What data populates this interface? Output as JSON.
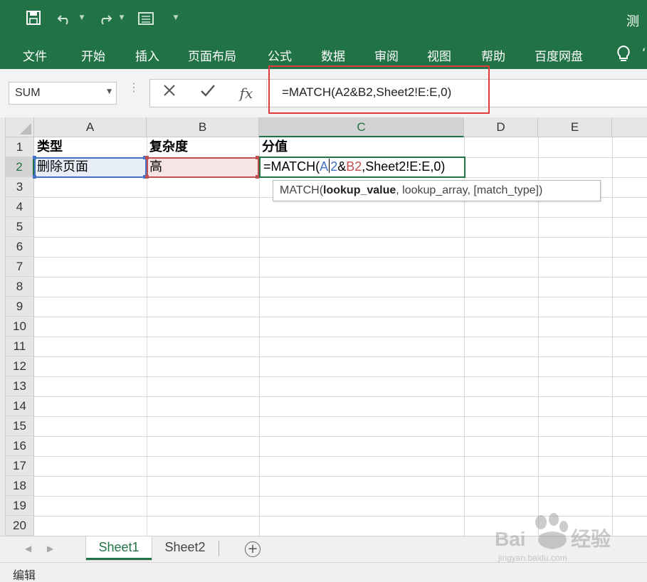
{
  "titlebar": {
    "title": "测"
  },
  "ribbon": {
    "tabs": [
      "文件",
      "开始",
      "插入",
      "页面布局",
      "公式",
      "数据",
      "审阅",
      "视图",
      "帮助",
      "百度网盘"
    ],
    "edge": "‘"
  },
  "formula_bar": {
    "name_box": "SUM",
    "fx_label": "fx",
    "formula": "=MATCH(A2&B2,Sheet2!E:E,0)"
  },
  "grid": {
    "columns": [
      "A",
      "B",
      "C",
      "D",
      "E"
    ],
    "rows": [
      "1",
      "2",
      "3",
      "4",
      "5",
      "6",
      "7",
      "8",
      "9",
      "10",
      "11",
      "12",
      "13",
      "14",
      "15",
      "16",
      "17",
      "18",
      "19",
      "20"
    ],
    "cells": {
      "a1": "类型",
      "b1": "复杂度",
      "c1": "分值",
      "a2": "删除页面",
      "b2": "高"
    },
    "edit": {
      "part1": "=MATCH(",
      "ref_a_1": "A",
      "ref_a_2": "2",
      "amp": "&",
      "ref_b": "B2",
      "part2": ",Sheet2!E:E,0)"
    },
    "tooltip": {
      "fn": "MATCH(",
      "arg1": "lookup_value",
      "rest": ", lookup_array, [match_type])"
    }
  },
  "sheet_tabs": {
    "tabs": [
      "Sheet1",
      "Sheet2"
    ],
    "add_symbol": "+"
  },
  "status": {
    "mode": "编辑"
  },
  "colors": {
    "accent": "#217346",
    "highlight": "#e03a3a",
    "ref_a": "#4472c4",
    "ref_b": "#c0504d"
  }
}
